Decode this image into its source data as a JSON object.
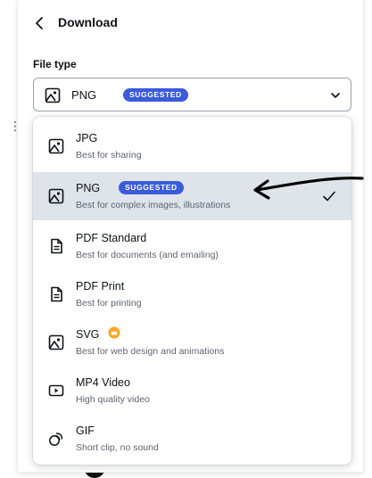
{
  "header": {
    "title": "Download"
  },
  "file_type": {
    "label": "File type",
    "selected_value": "PNG",
    "selected_badge": "SUGGESTED"
  },
  "options": [
    {
      "name": "JPG",
      "description": "Best for sharing",
      "icon": "image-icon"
    },
    {
      "name": "PNG",
      "description": "Best for complex images, illustrations",
      "icon": "image-icon",
      "badge": "SUGGESTED",
      "selected": true
    },
    {
      "name": "PDF Standard",
      "description": "Best for documents (and emailing)",
      "icon": "document-icon"
    },
    {
      "name": "PDF Print",
      "description": "Best for printing",
      "icon": "document-icon"
    },
    {
      "name": "SVG",
      "description": "Best for web design and animations",
      "icon": "image-icon",
      "pro": true
    },
    {
      "name": "MP4 Video",
      "description": "High quality video",
      "icon": "video-icon"
    },
    {
      "name": "GIF",
      "description": "Short clip, no sound",
      "icon": "gif-icon"
    }
  ],
  "colors": {
    "badge": "#3b5bdb",
    "selected_row": "#dfe3ea",
    "pro_crown": "#f5a623",
    "text": "#0e1318",
    "muted_text": "#5b6571"
  }
}
